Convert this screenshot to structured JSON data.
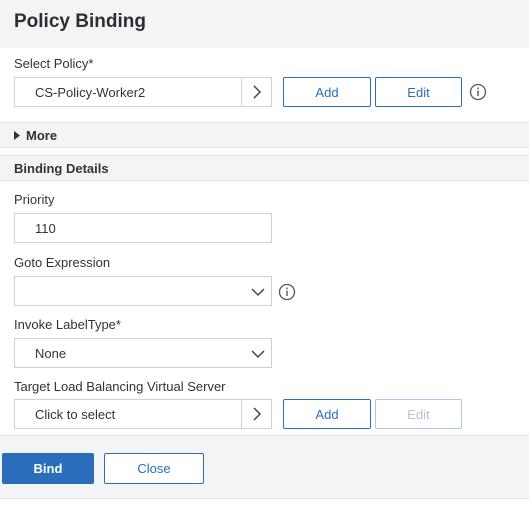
{
  "header": {
    "title": "Policy Binding"
  },
  "select_policy": {
    "label": "Select Policy*",
    "value": "CS-Policy-Worker2",
    "add_label": "Add",
    "edit_label": "Edit"
  },
  "more": {
    "label": "More"
  },
  "binding_details": {
    "section_label": "Binding Details",
    "priority": {
      "label": "Priority",
      "value": "110"
    },
    "goto_expression": {
      "label": "Goto Expression",
      "value": ""
    },
    "invoke_label_type": {
      "label": "Invoke LabelType*",
      "value": "None"
    },
    "target_lb_vserver": {
      "label": "Target Load Balancing Virtual Server",
      "value": "Click to select",
      "add_label": "Add",
      "edit_label": "Edit"
    }
  },
  "footer": {
    "bind_label": "Bind",
    "close_label": "Close"
  },
  "colors": {
    "accent": "#2a6ebb",
    "section_bg": "#f3f4f6"
  },
  "icons": [
    "chevron-right-icon",
    "info-icon",
    "caret-right-icon",
    "chevron-down-icon"
  ]
}
